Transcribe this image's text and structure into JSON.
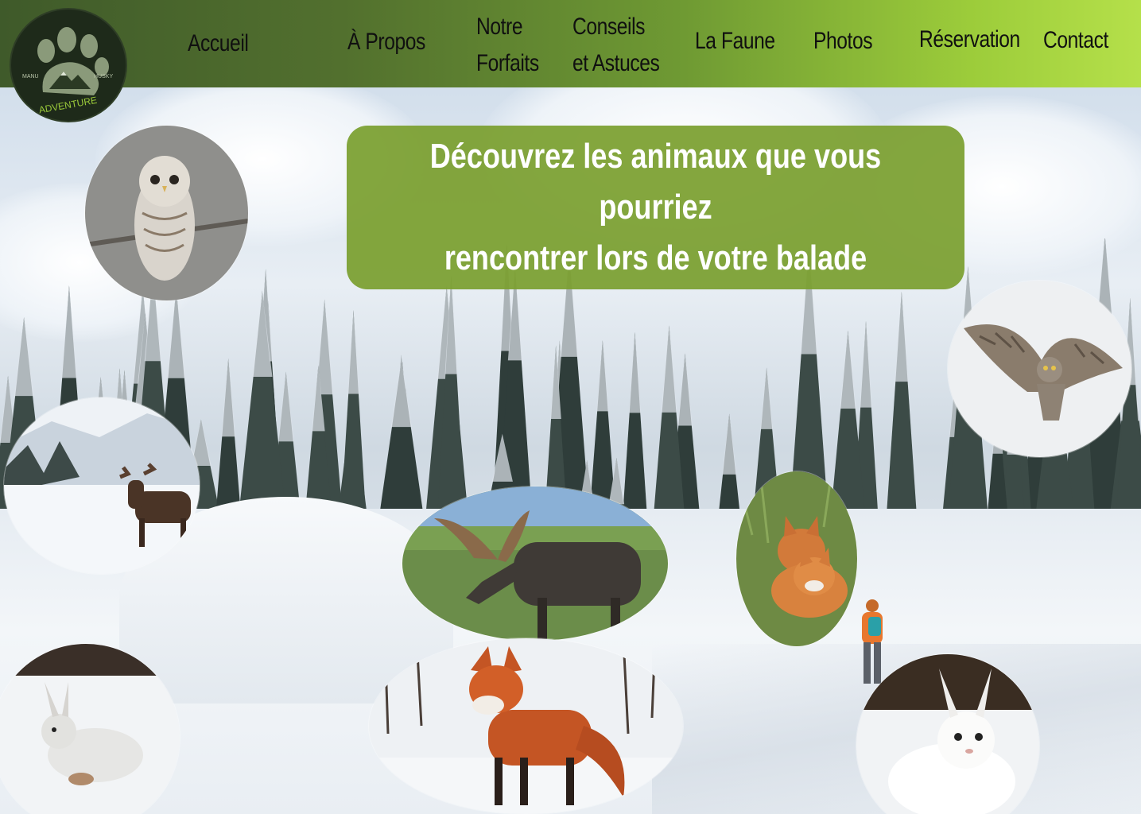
{
  "site": {
    "logo": {
      "icon": "paw-mountain-logo-icon",
      "text_left": "MANU",
      "text_right": "HUSKY",
      "text_bottom": "ADVENTURE"
    }
  },
  "nav": {
    "items": [
      {
        "label": "Accueil"
      },
      {
        "label": "À Propos"
      },
      {
        "label": "Notre",
        "label2": "Forfaits"
      },
      {
        "label": "Conseils",
        "label2": "et Astuces"
      },
      {
        "label": "La Faune"
      },
      {
        "label": "Photos"
      },
      {
        "label": "Réservation"
      },
      {
        "label": "Contact"
      }
    ]
  },
  "hero": {
    "line1": "Découvrez les animaux que vous pourriez",
    "line2": "rencontrer lors de votre balade"
  },
  "gallery": {
    "photos": [
      {
        "subject": "barred-owl-icon"
      },
      {
        "subject": "moose-in-snow-icon"
      },
      {
        "subject": "snowshoe-hare-running-icon"
      },
      {
        "subject": "moose-grazing-icon"
      },
      {
        "subject": "red-fox-icon"
      },
      {
        "subject": "fox-kits-icon"
      },
      {
        "subject": "great-grey-owl-flying-icon"
      },
      {
        "subject": "white-hare-icon"
      }
    ]
  },
  "colors": {
    "header_dark": "#3f5a2a",
    "header_light": "#b5e04a",
    "hero_bg": "#7a9e2e",
    "hero_text": "#ffffff",
    "nav_text": "#101010"
  }
}
